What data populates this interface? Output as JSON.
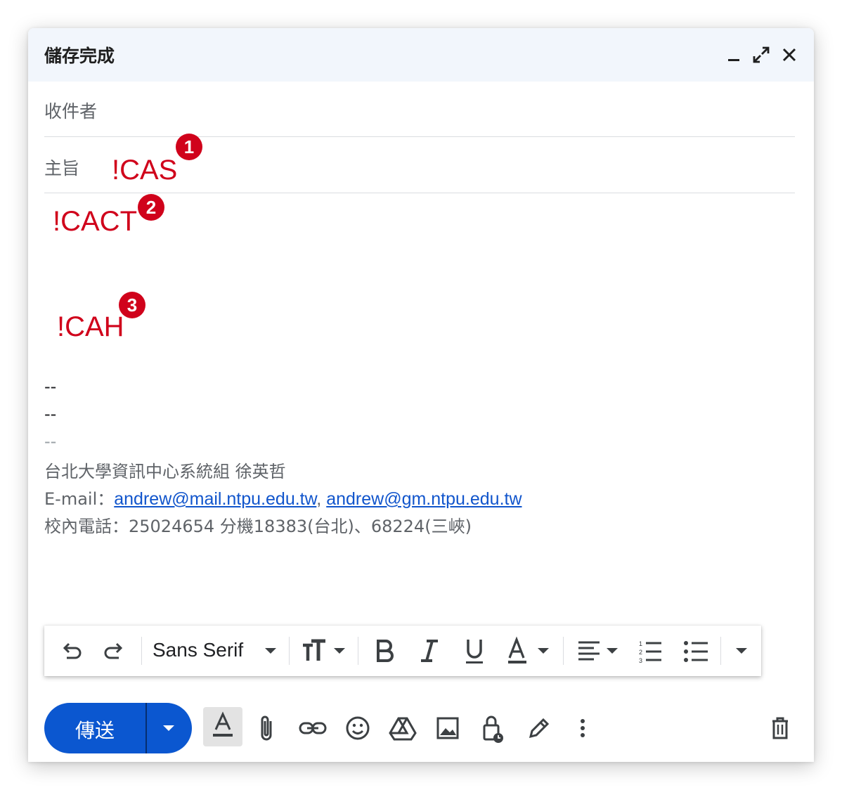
{
  "window": {
    "title": "儲存完成",
    "minimize_icon": "minimize-icon",
    "expand_icon": "expand-icon",
    "close_icon": "close-icon"
  },
  "fields": {
    "to_label": "收件者",
    "subject_label": "主旨"
  },
  "annotations": [
    {
      "text": "!CAS",
      "badge": "1"
    },
    {
      "text": "!CACT",
      "badge": "2"
    },
    {
      "text": "!CAH",
      "badge": "3"
    }
  ],
  "signature": {
    "dash1": "--",
    "dash2": "--",
    "dash3": "--",
    "org": "台北大學資訊中心系統組 徐英哲",
    "email_prefix": "E-mail：",
    "email1": "andrew@mail.ntpu.edu.tw",
    "email_sep": ", ",
    "email2": "andrew@gm.ntpu.edu.tw",
    "phone": "校內電話：25024654 分機18383(台北)、68224(三峽)"
  },
  "format_toolbar": {
    "font": "Sans Serif",
    "tools": [
      "undo-icon",
      "redo-icon",
      "font-family-dropdown",
      "text-size-icon",
      "bold-icon",
      "italic-icon",
      "underline-icon",
      "text-color-icon",
      "align-icon",
      "numbered-list-icon",
      "bulleted-list-icon",
      "more-formatting-icon"
    ]
  },
  "bottom_bar": {
    "send_label": "傳送",
    "icons": [
      "formatting-options-icon",
      "attach-icon",
      "link-icon",
      "emoji-icon",
      "drive-icon",
      "photo-icon",
      "confidential-mode-icon",
      "signature-icon",
      "more-options-icon",
      "discard-draft-icon"
    ]
  },
  "colors": {
    "annotation": "#d0021b",
    "send_button": "#0b57d0",
    "title_bar": "#f2f6fc",
    "link": "#1155cc"
  }
}
